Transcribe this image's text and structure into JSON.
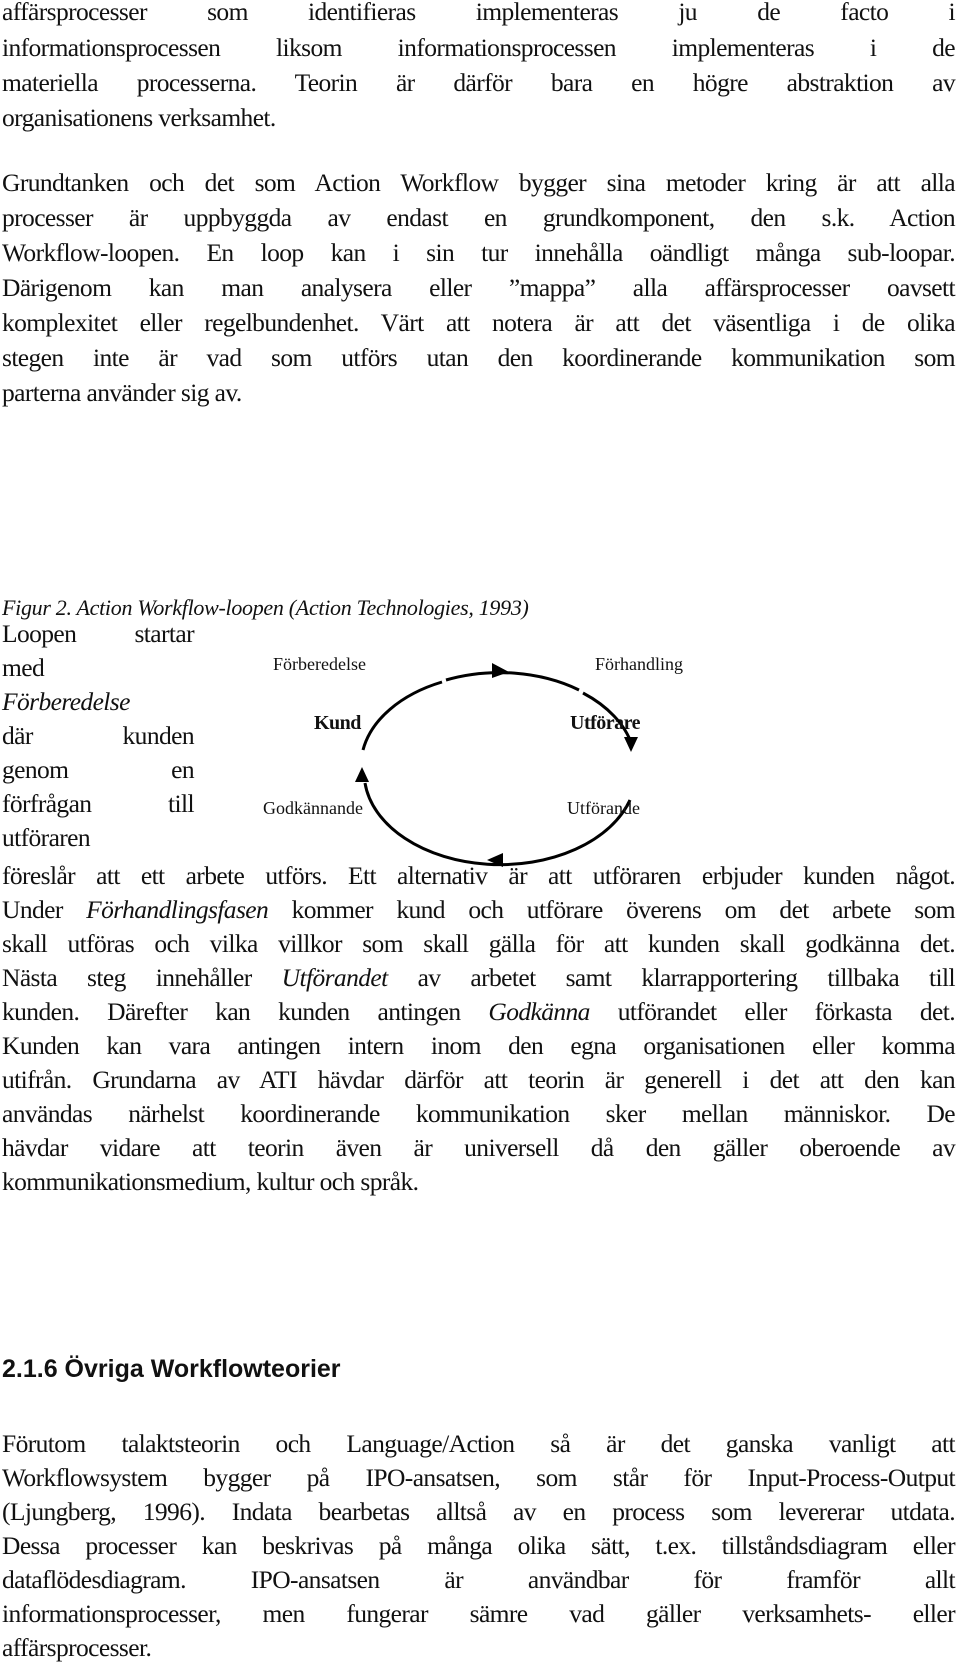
{
  "para1": {
    "lines": [
      "affärsprocesser som identifieras implementeras ju de facto i",
      "informationsprocessen liksom informationsprocessen implementeras i de",
      "materiella processerna. Teorin är därför bara en högre abstraktion av",
      "organisationens verksamhet."
    ]
  },
  "para2": {
    "lines": [
      "Grundtanken och det som Action Workflow bygger sina metoder kring är att alla",
      "processer är uppbyggda av endast en grundkomponent, den s.k. Action",
      "Workflow-loopen. En loop kan i sin tur innehålla oändligt många sub-loopar.",
      "Därigenom kan man analysera eller ”mappa” alla affärsprocesser oavsett",
      "komplexitet eller regelbundenhet. Värt att notera är att det väsentliga i de olika",
      "stegen inte är vad som utförs utan den koordinerande kommunikation som",
      "parterna använder sig av."
    ]
  },
  "figure": {
    "caption": "Figur 2. Action Workflow-loopen (Action Technologies, 1993)",
    "labels": {
      "top_left": "Förberedelse",
      "top_right": "Förhandling",
      "left": "Kund",
      "right": "Utförare",
      "bottom_left": "Godkännande",
      "bottom_right": "Utförande"
    }
  },
  "para3": {
    "side_lines": [
      "Loopen startar",
      "med",
      "Förberedelse",
      "där kunden",
      "genom en",
      "förfrågan till",
      "utföraren"
    ],
    "l1": "föreslår att ett arbete utförs. Ett alternativ är att utföraren erbjuder kunden något.",
    "l2_a": "Under ",
    "l2_em": "Förhandlingsfasen",
    "l2_b": " kommer kund och utförare överens om det arbete som",
    "l3": "skall utföras och vilka villkor som skall gälla för att kunden skall godkänna det.",
    "l4_a": "Nästa steg innehåller ",
    "l4_em": "Utförandet",
    "l4_b": " av arbetet samt klarrapportering tillbaka till",
    "l5_a": "kunden. Därefter kan kunden antingen ",
    "l5_em": "Godkänna",
    "l5_b": " utförandet eller förkasta det.",
    "l6": "Kunden kan vara antingen intern inom den egna organisationen eller komma",
    "l7": "utifrån. Grundarna av ATI hävdar därför att teorin är generell i det att den kan",
    "l8": "användas närhelst koordinerande kommunikation sker mellan människor. De",
    "l9": "hävdar vidare att teorin även är universell då den gäller oberoende av",
    "l10": "kommunikationsmedium, kultur och språk."
  },
  "section": {
    "heading": "2.1.6 Övriga Workflowteorier"
  },
  "para4": {
    "lines": [
      "Förutom talaktsteorin och Language/Action så är det ganska vanligt att",
      "Workflowsystem bygger på IPO-ansatsen, som står för Input-Process-Output",
      "(Ljungberg, 1996). Indata bearbetas alltså av en process som levererar utdata.",
      "Dessa processer kan beskrivas på många olika sätt, t.ex. tillståndsdiagram eller",
      "dataflödesdiagram. IPO-ansatsen är användbar för framför allt",
      "informationsprocesser, men fungerar sämre vad gäller verksamhets- eller",
      "affärsprocesser."
    ]
  }
}
